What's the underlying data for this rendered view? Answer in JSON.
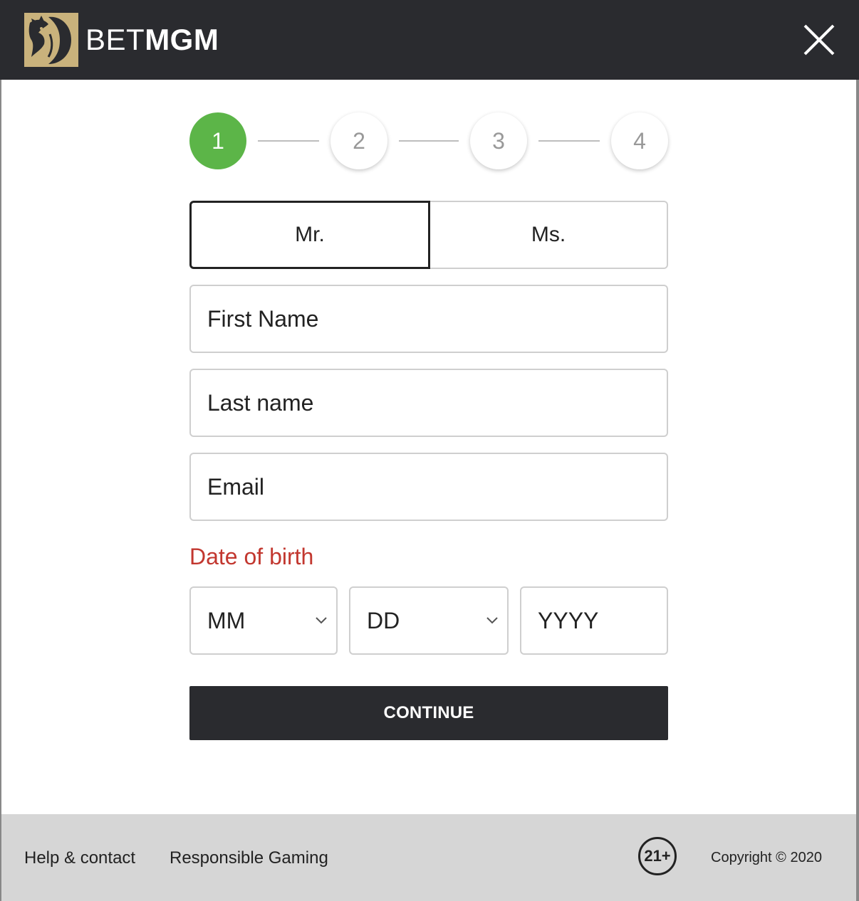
{
  "header": {
    "brand_light": "BET",
    "brand_bold": "MGM",
    "brand_gold": "#c9b27c",
    "background": "#2a2b2f"
  },
  "stepper": {
    "steps": [
      "1",
      "2",
      "3",
      "4"
    ],
    "active_step": "1",
    "active_color": "#5cb548"
  },
  "salutation": {
    "options": [
      "Mr.",
      "Ms."
    ],
    "selected": "Mr."
  },
  "form": {
    "first_name_placeholder": "First Name",
    "last_name_placeholder": "Last name",
    "email_placeholder": "Email",
    "dob_label": "Date of birth",
    "dob_label_color": "#c2372f",
    "dob_month": "MM",
    "dob_day": "DD",
    "dob_year": "YYYY",
    "continue_label": "CONTINUE"
  },
  "footer": {
    "help_link": "Help & contact",
    "responsible_link": "Responsible Gaming",
    "age_badge": "21+",
    "copyright": "Copyright © 2020"
  }
}
